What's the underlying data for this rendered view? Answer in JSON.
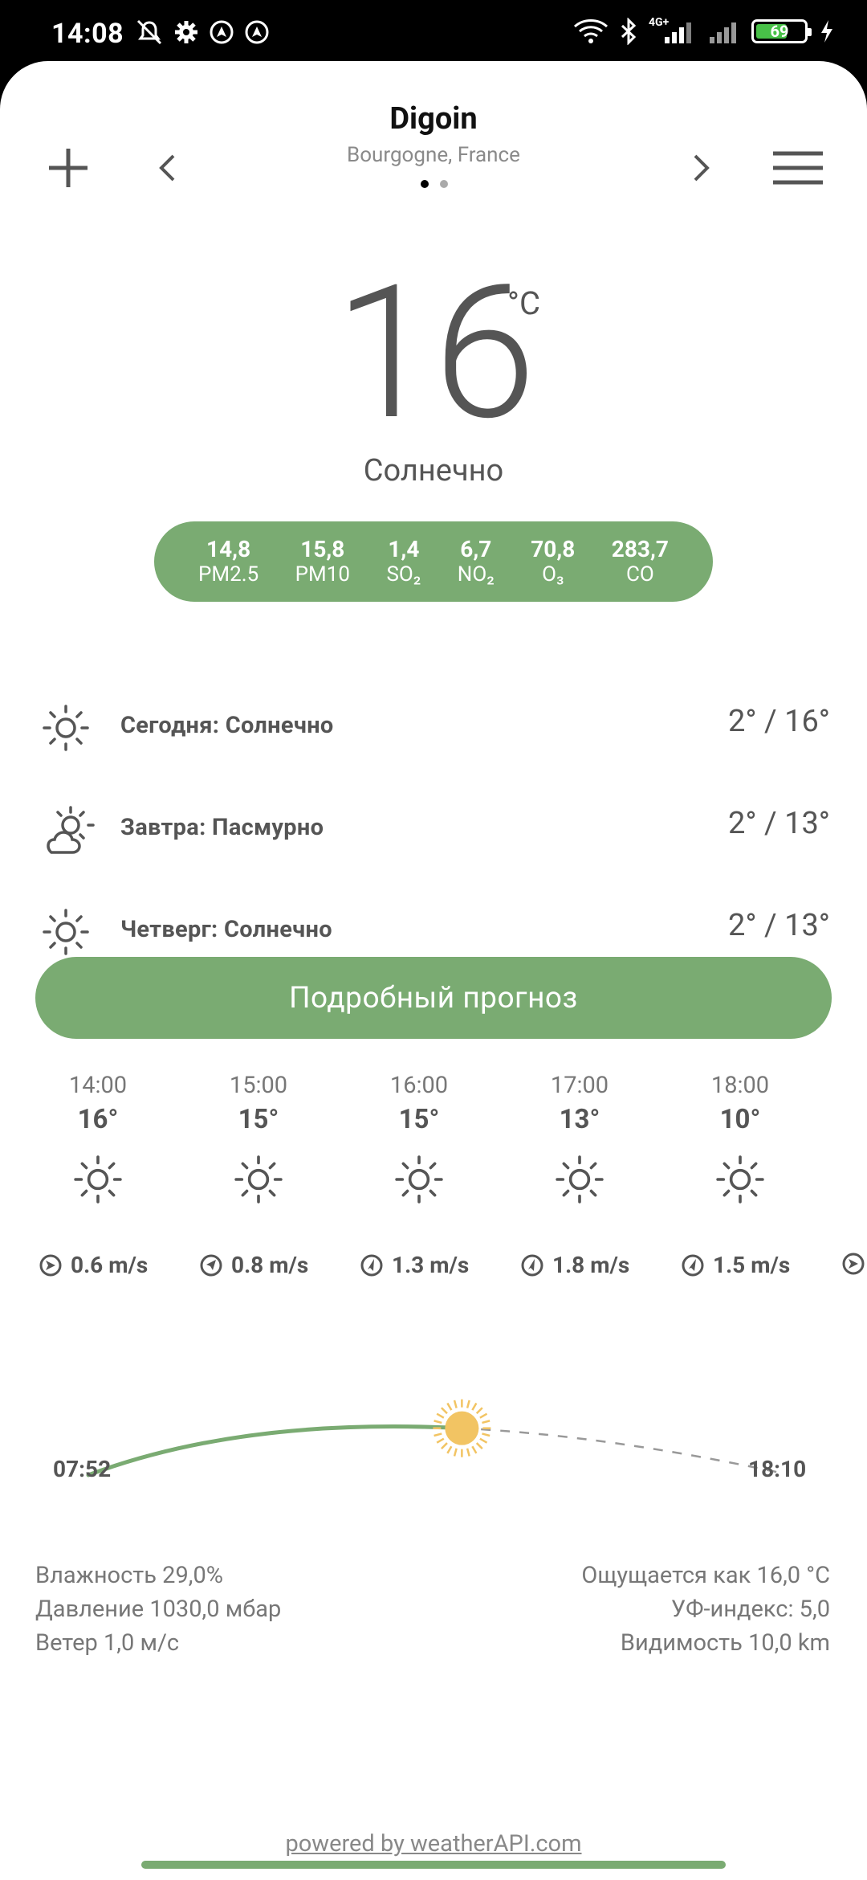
{
  "status_bar": {
    "time": "14:08",
    "network": "4G+",
    "battery": "69",
    "battery_level": 0.69
  },
  "header": {
    "city": "Digoin",
    "region": "Bourgogne, France",
    "page_dots": 2,
    "active_page": 1
  },
  "current": {
    "temperature": "16",
    "unit": "°C",
    "condition": "Солнечно"
  },
  "air_quality": [
    {
      "value": "14,8",
      "label": "PM2.5"
    },
    {
      "value": "15,8",
      "label": "PM10"
    },
    {
      "value": "1,4",
      "label": "SO₂"
    },
    {
      "value": "6,7",
      "label": "NO₂"
    },
    {
      "value": "70,8",
      "label": "O₃"
    },
    {
      "value": "283,7",
      "label": "CO"
    }
  ],
  "daily": [
    {
      "icon": "sun-icon",
      "label": "Сегодня: Солнечно",
      "temps": "2° / 16°"
    },
    {
      "icon": "partly-cloudy-icon",
      "label": "Завтра: Пасмурно",
      "temps": "2° / 13°"
    },
    {
      "icon": "sun-icon",
      "label": "Четверг: Солнечно",
      "temps": "2° / 13°"
    }
  ],
  "forecast_button": "Подробный прогноз",
  "hourly": [
    {
      "time": "14:00",
      "temp": "16°",
      "icon": "sun-icon",
      "wind": "0.6 m/s"
    },
    {
      "time": "15:00",
      "temp": "15°",
      "icon": "sun-icon",
      "wind": "0.8 m/s"
    },
    {
      "time": "16:00",
      "temp": "15°",
      "icon": "sun-icon",
      "wind": "1.3 m/s"
    },
    {
      "time": "17:00",
      "temp": "13°",
      "icon": "sun-icon",
      "wind": "1.8 m/s"
    },
    {
      "time": "18:00",
      "temp": "10°",
      "icon": "sun-icon",
      "wind": "1.5 m/s"
    }
  ],
  "sun": {
    "sunrise": "07:52",
    "sunset": "18:10",
    "day_progress": 0.6
  },
  "details": {
    "humidity": "Влажность 29,0%",
    "pressure": "Давление 1030,0 мбар",
    "wind": "Ветер 1,0 м/с",
    "feels_like": "Ощущается как 16,0 °C",
    "uv": "УФ-индекс: 5,0",
    "visibility": "Видимость 10,0 km"
  },
  "footer": {
    "powered_by": "powered by weatherAPI.com"
  },
  "colors": {
    "accent": "#7aab72",
    "sun": "#f2c463",
    "text": "#555555"
  }
}
